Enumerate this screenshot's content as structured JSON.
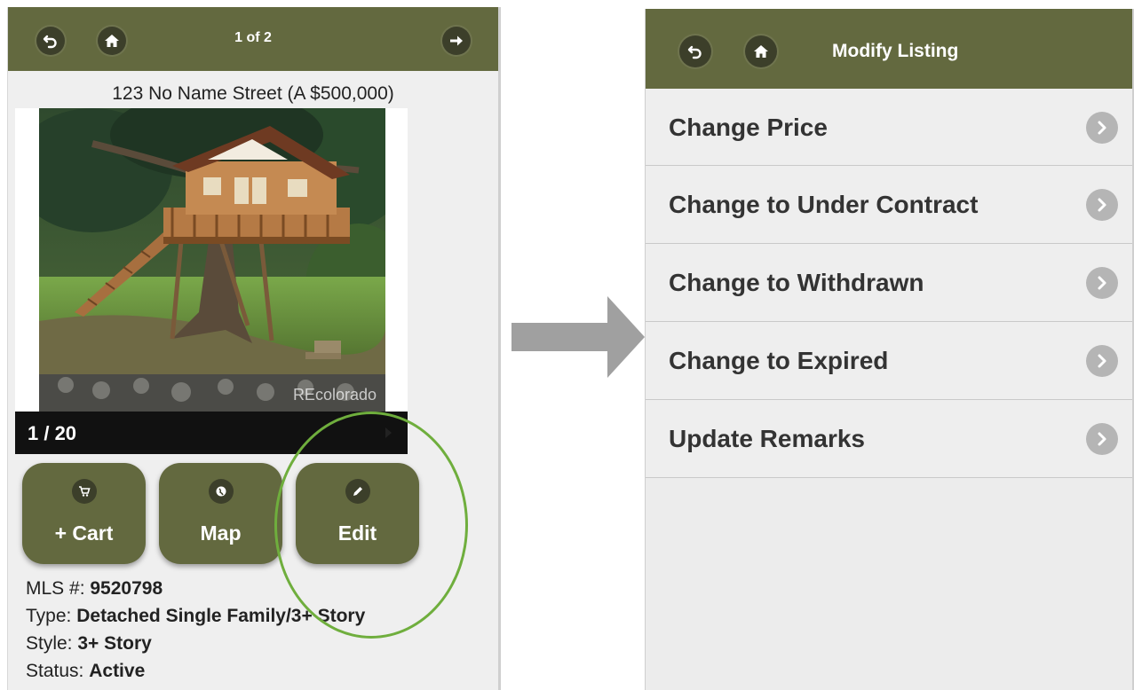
{
  "left": {
    "pager": "1 of 2",
    "address": "123 No Name Street (A $500,000)",
    "photo": {
      "watermark": "REcolorado",
      "counter": "1 / 20"
    },
    "actions": [
      {
        "label": "+ Cart",
        "icon": "cart-icon"
      },
      {
        "label": "Map",
        "icon": "globe-icon"
      },
      {
        "label": "Edit",
        "icon": "pencil-icon"
      }
    ],
    "details": {
      "mls_label": "MLS #:",
      "mls_value": "9520798",
      "type_label": "Type:",
      "type_value": "Detached Single Family/3+ Story",
      "style_label": "Style:",
      "style_value": "3+ Story",
      "status_label": "Status:",
      "status_value": "Active"
    }
  },
  "right": {
    "title": "Modify Listing",
    "menu": [
      {
        "label": "Change Price"
      },
      {
        "label": "Change to Under Contract"
      },
      {
        "label": "Change to Withdrawn"
      },
      {
        "label": "Change to Expired"
      },
      {
        "label": "Update Remarks"
      }
    ]
  },
  "colors": {
    "header": "#63693f",
    "highlight": "#6fae3d",
    "arrow": "#a0a0a0"
  }
}
